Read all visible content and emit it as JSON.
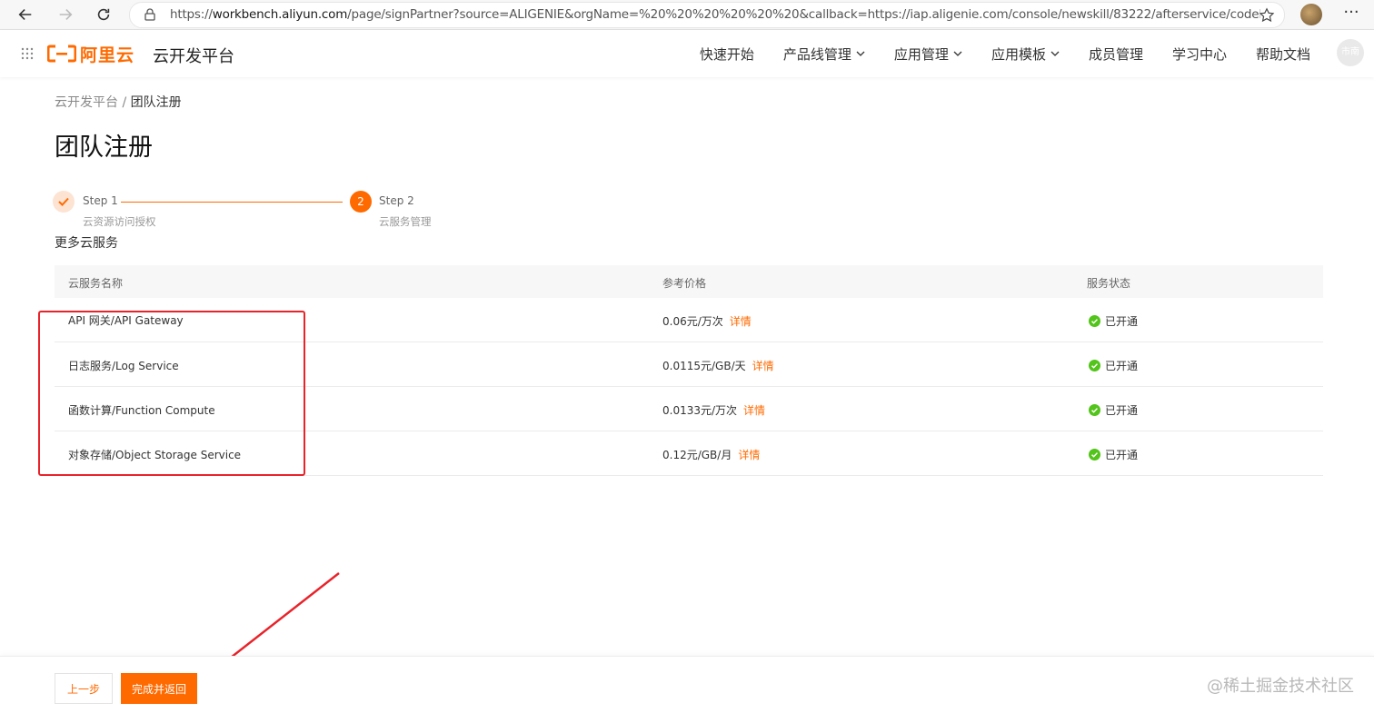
{
  "browser": {
    "url_scheme": "https://",
    "url_host": "workbench.aliyun.com",
    "url_rest": "/page/signPartner?source=ALIGENIE&orgName=%20%20%20%20%20%20&callback=https://iap.aligenie.com/console/newskill/83222/afterservice/codeFormEdit"
  },
  "header": {
    "logo_text": "阿里云",
    "platform_title": "云开发平台",
    "nav": [
      {
        "label": "快速开始"
      },
      {
        "label": "产品线管理"
      },
      {
        "label": "应用管理"
      },
      {
        "label": "应用模板"
      },
      {
        "label": "成员管理"
      },
      {
        "label": "学习中心"
      },
      {
        "label": "帮助文档"
      }
    ],
    "avatar_text": "市南"
  },
  "breadcrumb": {
    "parent": "云开发平台",
    "separator": " / ",
    "current": "团队注册"
  },
  "page_title": "团队注册",
  "steps": [
    {
      "title": "Step 1",
      "desc": "云资源访问授权",
      "state": "done"
    },
    {
      "title": "Step 2",
      "desc": "云服务管理",
      "state": "active",
      "number": "2"
    }
  ],
  "section_title": "更多云服务",
  "table": {
    "columns": [
      "云服务名称",
      "参考价格",
      "服务状态"
    ],
    "rows": [
      {
        "name": "API 网关/API Gateway",
        "price": "0.06元/万次",
        "link": "详情",
        "status": "已开通"
      },
      {
        "name": "日志服务/Log Service",
        "price": "0.0115元/GB/天",
        "link": "详情",
        "status": "已开通"
      },
      {
        "name": "函数计算/Function Compute",
        "price": "0.0133元/万次",
        "link": "详情",
        "status": "已开通"
      },
      {
        "name": "对象存储/Object Storage Service",
        "price": "0.12元/GB/月",
        "link": "详情",
        "status": "已开通"
      }
    ]
  },
  "footer": {
    "prev_label": "上一步",
    "finish_label": "完成并返回"
  },
  "watermark": "@稀土掘金技术社区",
  "colors": {
    "accent": "#ff6a00",
    "success": "#52c41a",
    "annotation": "#e8232a"
  }
}
